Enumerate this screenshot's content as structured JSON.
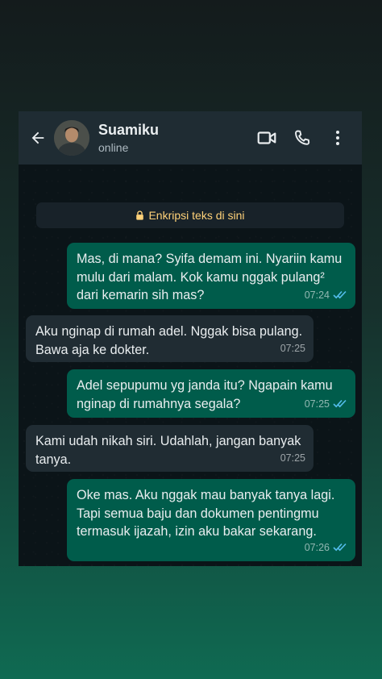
{
  "header": {
    "contact_name": "Suamiku",
    "status": "online"
  },
  "encryption_notice": "Enkripsi teks di sini",
  "messages": [
    {
      "direction": "out",
      "text": "Mas, di mana? Syifa demam ini. Nyariin kamu mulu dari malam. Kok kamu nggak pulang² dari kemarin sih mas?",
      "time": "07:24",
      "read": true
    },
    {
      "direction": "in",
      "text": "Aku nginap di rumah adel. Nggak bisa pulang. Bawa aja ke dokter.",
      "time": "07:25"
    },
    {
      "direction": "out",
      "text": "Adel sepupumu yg janda itu? Ngapain kamu nginap di rumahnya segala?",
      "time": "07:25",
      "read": true
    },
    {
      "direction": "in",
      "text": "Kami udah nikah siri. Udahlah, jangan banyak tanya.",
      "time": "07:25"
    },
    {
      "direction": "out",
      "text": "Oke mas. Aku nggak mau banyak tanya lagi. Tapi semua baju dan dokumen pentingmu termasuk ijazah, izin aku bakar sekarang.",
      "time": "07:26",
      "read": true
    }
  ],
  "colors": {
    "outgoing_bubble": "#005c4b",
    "incoming_bubble": "#202c33",
    "read_ticks": "#53bdeb",
    "encryption_text": "#ffd279"
  }
}
